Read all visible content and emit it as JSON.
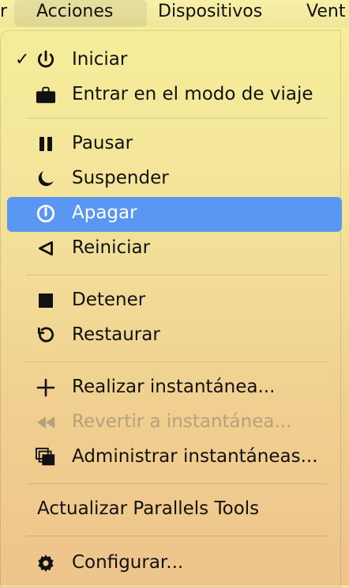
{
  "menubar": {
    "left_partial": "r",
    "acciones": "Acciones",
    "dispositivos": "Dispositivos",
    "right_partial": "Vent"
  },
  "menu": {
    "checkmark": "✓",
    "items": {
      "iniciar": "Iniciar",
      "entrar_modo_viaje": "Entrar en el modo de viaje",
      "pausar": "Pausar",
      "suspender": "Suspender",
      "apagar": "Apagar",
      "reiniciar": "Reiniciar",
      "detener": "Detener",
      "restaurar": "Restaurar",
      "realizar_instantanea": "Realizar instantánea...",
      "revertir_instantanea": "Revertir a instantánea...",
      "administrar_instantaneas": "Administrar instantáneas...",
      "actualizar_parallels": "Actualizar Parallels Tools",
      "configurar": "Configurar..."
    }
  },
  "colors": {
    "highlight": "#5a97f2",
    "disabled_text": "#b3a27a"
  },
  "icons": {
    "iniciar": "power-icon",
    "entrar_modo_viaje": "briefcase-icon",
    "pausar": "pause-icon",
    "suspender": "moon-icon",
    "apagar": "shutdown-icon",
    "reiniciar": "restart-icon",
    "detener": "stop-icon",
    "restaurar": "restore-icon",
    "realizar_instantanea": "plus-icon",
    "revertir_instantanea": "rewind-icon",
    "administrar_instantaneas": "snapshots-icon",
    "configurar": "gear-icon"
  }
}
